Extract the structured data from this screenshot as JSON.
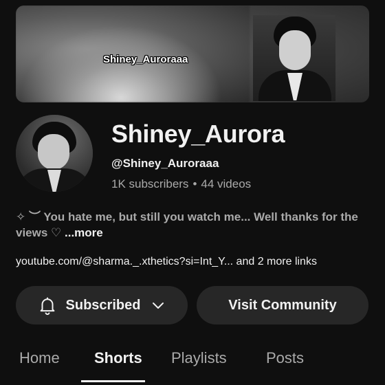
{
  "banner": {
    "label": "Shiney_Auroraaa"
  },
  "channel": {
    "name": "Shiney_Aurora",
    "handle": "@Shiney_Auroraaa",
    "subscribers": "1K subscribers",
    "separator": "•",
    "videos": "44 videos"
  },
  "description": {
    "text": "✧ ︶ You hate me, but still you watch me... Well thanks for the views ♡ ",
    "more_label": "...more"
  },
  "links": {
    "url": "youtube.com/@sharma._.xthetics?si=Int_Y...",
    "extra": " and 2 more links"
  },
  "actions": {
    "subscribed_label": "Subscribed",
    "community_label": "Visit Community"
  },
  "tabs": [
    {
      "label": "Home"
    },
    {
      "label": "Shorts",
      "active": true
    },
    {
      "label": "Playlists"
    },
    {
      "label": "Posts"
    }
  ],
  "icons": {
    "bell": "bell-icon",
    "chevron": "chevron-down-icon"
  },
  "colors": {
    "background": "#0f0f0f",
    "button": "#272727",
    "text": "#f1f1f1",
    "muted": "#aaaaaa"
  }
}
